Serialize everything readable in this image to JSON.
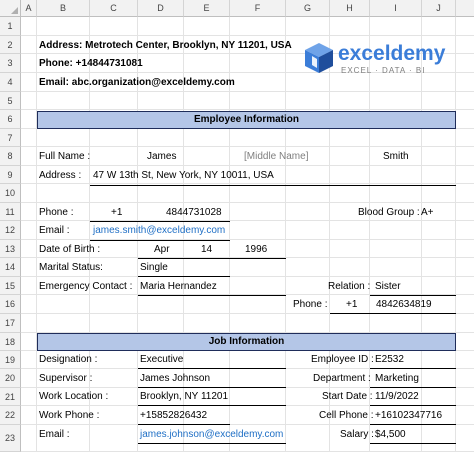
{
  "columns": [
    "A",
    "B",
    "C",
    "D",
    "E",
    "F",
    "G",
    "H",
    "I",
    "J"
  ],
  "rows": [
    "1",
    "2",
    "3",
    "4",
    "5",
    "6",
    "7",
    "8",
    "9",
    "10",
    "11",
    "12",
    "13",
    "14",
    "15",
    "16",
    "17",
    "18",
    "19",
    "20",
    "21",
    "22",
    "23"
  ],
  "header": {
    "address": "Address: Metrotech Center, Brooklyn, NY 11201, USA",
    "phone": "Phone: +14844731081",
    "email": "Email: abc.organization@exceldemy.com"
  },
  "logo": {
    "name": "exceldemy",
    "tagline": "EXCEL · DATA · BI",
    "icon": "exceldemy-cube-logo",
    "brand_color": "#3b7dd8"
  },
  "employee_section": {
    "title": "Employee Information",
    "full_name_label": "Full Name :",
    "first_name": "James",
    "middle_name": "[Middle Name]",
    "last_name": "Smith",
    "address_label": "Address :",
    "address": "47 W 13th St, New York, NY 10011, USA",
    "phone_label": "Phone :",
    "phone_code": "+1",
    "phone_number": "4844731028",
    "blood_group_label": "Blood Group :",
    "blood_group": "A+",
    "email_label": "Email :",
    "email": "james.smith@exceldemy.com",
    "dob_label": "Date of Birth :",
    "dob_month": "Apr",
    "dob_day": "14",
    "dob_year": "1996",
    "marital_label": "Marital Status:",
    "marital": "Single",
    "emergency_label": "Emergency Contact :",
    "emergency": "Maria Hernandez",
    "relation_label": "Relation :",
    "relation": "Sister",
    "ec_phone_label": "Phone :",
    "ec_phone_code": "+1",
    "ec_phone_number": "4842634819"
  },
  "job_section": {
    "title": "Job Information",
    "designation_label": "Designation :",
    "designation": "Executive",
    "employee_id_label": "Employee ID :",
    "employee_id": "E2532",
    "supervisor_label": "Supervisor :",
    "supervisor": "James Johnson",
    "department_label": "Department :",
    "department": "Marketing",
    "work_location_label": "Work Location :",
    "work_location": "Brooklyn, NY 11201",
    "start_date_label": "Start Date :",
    "start_date": "11/9/2022",
    "work_phone_label": "Work Phone :",
    "work_phone": "+15852826432",
    "cell_phone_label": "Cell Phone :",
    "cell_phone": "+16102347716",
    "email_label": "Email :",
    "email": "james.johnson@exceldemy.com",
    "salary_label": "Salary :",
    "salary": "$4,500"
  },
  "colors": {
    "banner_fill": "#b4c6e7",
    "banner_border": "#1f2d5a",
    "link": "#1f6fc5",
    "header_fill": "#f2f2f2"
  }
}
